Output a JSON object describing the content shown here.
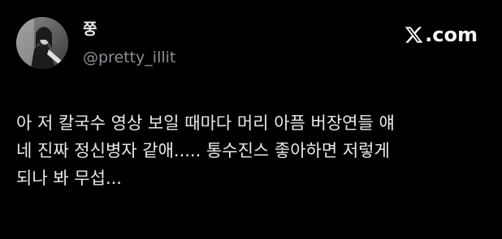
{
  "post": {
    "author": {
      "display_name": "쭝",
      "handle": "@pretty_illit",
      "avatar_icon": "profile-photo"
    },
    "brand": {
      "icon": "x-logo-icon",
      "label": ".com"
    },
    "text_lines": [
      "아 저 칼국수 영상 보일 때마다 머리 아픔 버장연들 얘",
      "네 진짜 정신병자 같애..... 통수진스 좋아하면 저렇게",
      "되나 봐 무섭..."
    ]
  },
  "colors": {
    "background": "#000000",
    "primary_text": "#e7e9ea",
    "secondary_text": "#8b9198"
  }
}
